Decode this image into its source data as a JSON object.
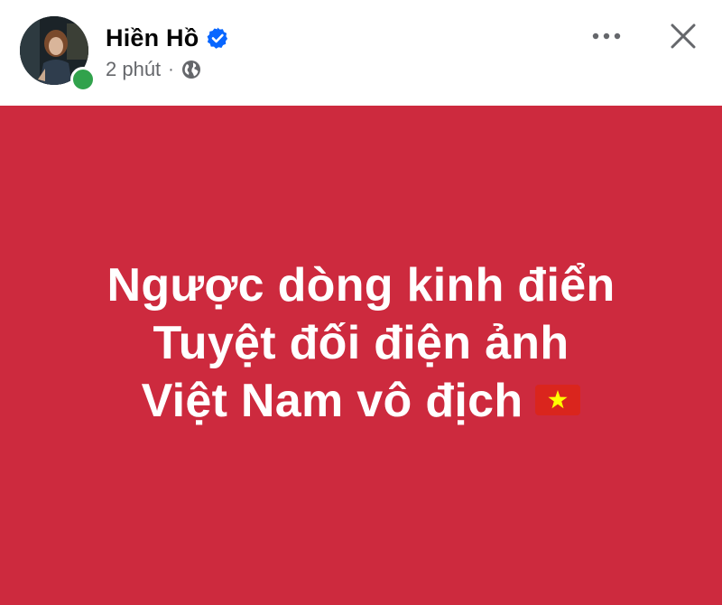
{
  "post": {
    "author": {
      "name": "Hiền Hồ",
      "verified": true,
      "online": true
    },
    "time": "2 phút",
    "separator": "·",
    "privacy_icon": "globe-icon",
    "text_lines": [
      "Ngược dòng kinh điển",
      "Tuyệt đối điện ảnh",
      "Việt Nam vô địch"
    ],
    "emoji": "vietnam-flag-icon",
    "background_color": "#cd2a3e",
    "text_color": "#ffffff"
  },
  "header": {
    "more_icon": "more-horizontal-icon",
    "close_icon": "close-icon"
  },
  "colors": {
    "verified_blue": "#0866ff",
    "online_green": "#31a24c",
    "secondary_text": "#65676b",
    "flag_red": "#da251d",
    "flag_star": "#ffff00"
  }
}
